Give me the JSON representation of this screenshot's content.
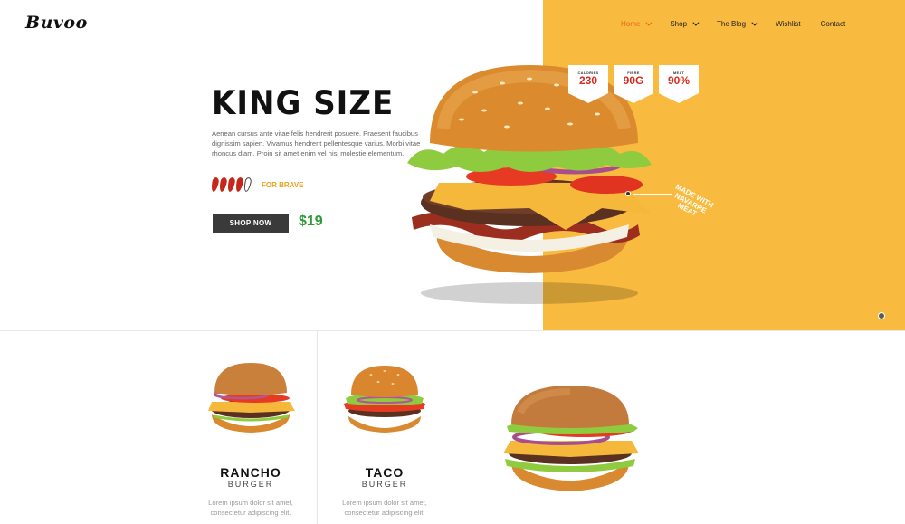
{
  "brand": {
    "logo": "Buvoo"
  },
  "nav": {
    "items": [
      {
        "label": "Home",
        "has_dropdown": true,
        "active": true
      },
      {
        "label": "Shop",
        "has_dropdown": true
      },
      {
        "label": "The Blog",
        "has_dropdown": true
      },
      {
        "label": "Wishlist",
        "has_dropdown": false
      },
      {
        "label": "Contact",
        "has_dropdown": false
      }
    ]
  },
  "hero": {
    "title": "KING SIZE",
    "description": "Aenean cursus ante vitae felis hendrerit posuere. Praesent faucibus dignissim sapien. Vivamus hendrerit pellentesque varius. Morbi vitae rhoncus diam. Proin sit amet enim vel nisi molestie elementum.",
    "spice_level": {
      "filled": 4,
      "total": 5,
      "label": "FOR BRAVE"
    },
    "shop_button": "SHOP NOW",
    "price": "$19",
    "badges": [
      {
        "label": "CALORIES",
        "value": "230"
      },
      {
        "label": "FIBRE",
        "value": "90G"
      },
      {
        "label": "MEAT",
        "value": "90%"
      }
    ],
    "annotation": "MADE WITH NAVARRE MEAT",
    "colors": {
      "accent_panel": "#F8BB3F",
      "price": "#2C9A35",
      "nav_active": "#E8661A",
      "badge_value": "#D62B1E"
    }
  },
  "products": [
    {
      "name": "RANCHO",
      "subtitle": "BURGER",
      "description": "Lorem ipsum dolor sit amet, consectetur adipiscing elit."
    },
    {
      "name": "TACO",
      "subtitle": "BURGER",
      "description": "Lorem ipsum dolor sit amet, consectetur adipiscing elit."
    }
  ]
}
